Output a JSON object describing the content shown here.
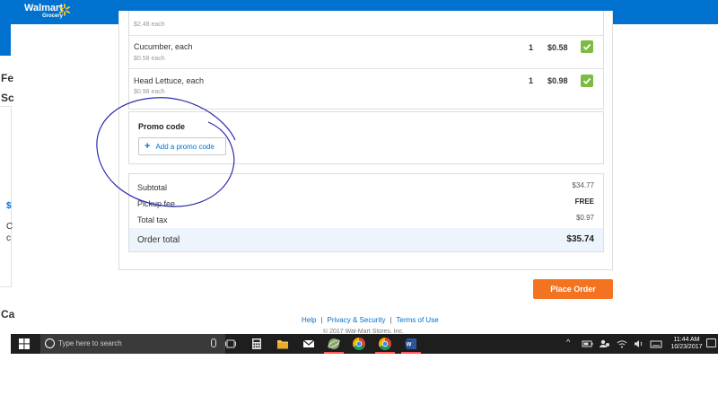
{
  "header": {
    "brand_name": "Walmart",
    "brand_sub": "Grocery",
    "bg_color": "#0071ce"
  },
  "background_page": {
    "fragments": [
      "Fe",
      "Sc",
      "$",
      "C",
      "c",
      "Ca"
    ]
  },
  "items": [
    {
      "name": "",
      "unit_price": "$2.48 each",
      "qty": "",
      "price": "",
      "checked": false
    },
    {
      "name": "Cucumber, each",
      "unit_price": "$0.58 each",
      "qty": "1",
      "price": "$0.58",
      "checked": true
    },
    {
      "name": "Head Lettuce, each",
      "unit_price": "$0.98 each",
      "qty": "1",
      "price": "$0.98",
      "checked": true
    }
  ],
  "promo": {
    "title": "Promo code",
    "button_label": "Add a promo code",
    "button_icon": "plus-icon"
  },
  "summary": {
    "subtotal_label": "Subtotal",
    "subtotal_value": "$34.77",
    "pickup_label": "Pickup fee",
    "pickup_value": "FREE",
    "tax_label": "Total tax",
    "tax_value": "$0.97",
    "total_label": "Order total",
    "total_value": "$35.74"
  },
  "actions": {
    "place_order": "Place Order",
    "accent_color": "#f47321"
  },
  "footer": {
    "help": "Help",
    "privacy": "Privacy & Security",
    "terms": "Terms of Use",
    "copyright": "© 2017 Wal-Mart Stores, Inc."
  },
  "taskbar": {
    "search_placeholder": "Type here to search",
    "time": "11:44 AM",
    "date": "10/23/2017",
    "pinned_icons": [
      "task-view-icon",
      "calculator-icon",
      "file-explorer-icon",
      "mail-icon",
      "app-icon",
      "chrome-icon",
      "chrome-icon",
      "word-icon"
    ]
  }
}
